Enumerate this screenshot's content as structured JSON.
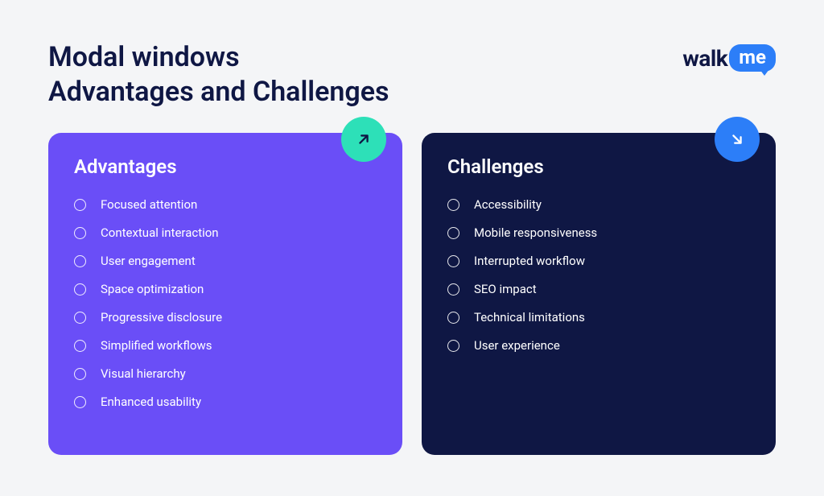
{
  "title_line1": "Modal windows",
  "title_line2": "Advantages and Challenges",
  "logo": {
    "part1": "walk",
    "part2": "me"
  },
  "advantages": {
    "title": "Advantages",
    "items": [
      "Focused attention",
      "Contextual interaction",
      "User engagement",
      "Space optimization",
      "Progressive disclosure",
      "Simplified workflows",
      "Visual hierarchy",
      "Enhanced usability"
    ]
  },
  "challenges": {
    "title": "Challenges",
    "items": [
      "Accessibility",
      "Mobile responsiveness",
      "Interrupted workflow",
      "SEO impact",
      "Technical limitations",
      "User experience"
    ]
  },
  "colors": {
    "background": "#f4f5f7",
    "titleText": "#0f1744",
    "advantagesCard": "#6a4ef7",
    "challengesCard": "#0f1744",
    "badgeUp": "#2de0b8",
    "badgeDown": "#2c7ef8"
  }
}
